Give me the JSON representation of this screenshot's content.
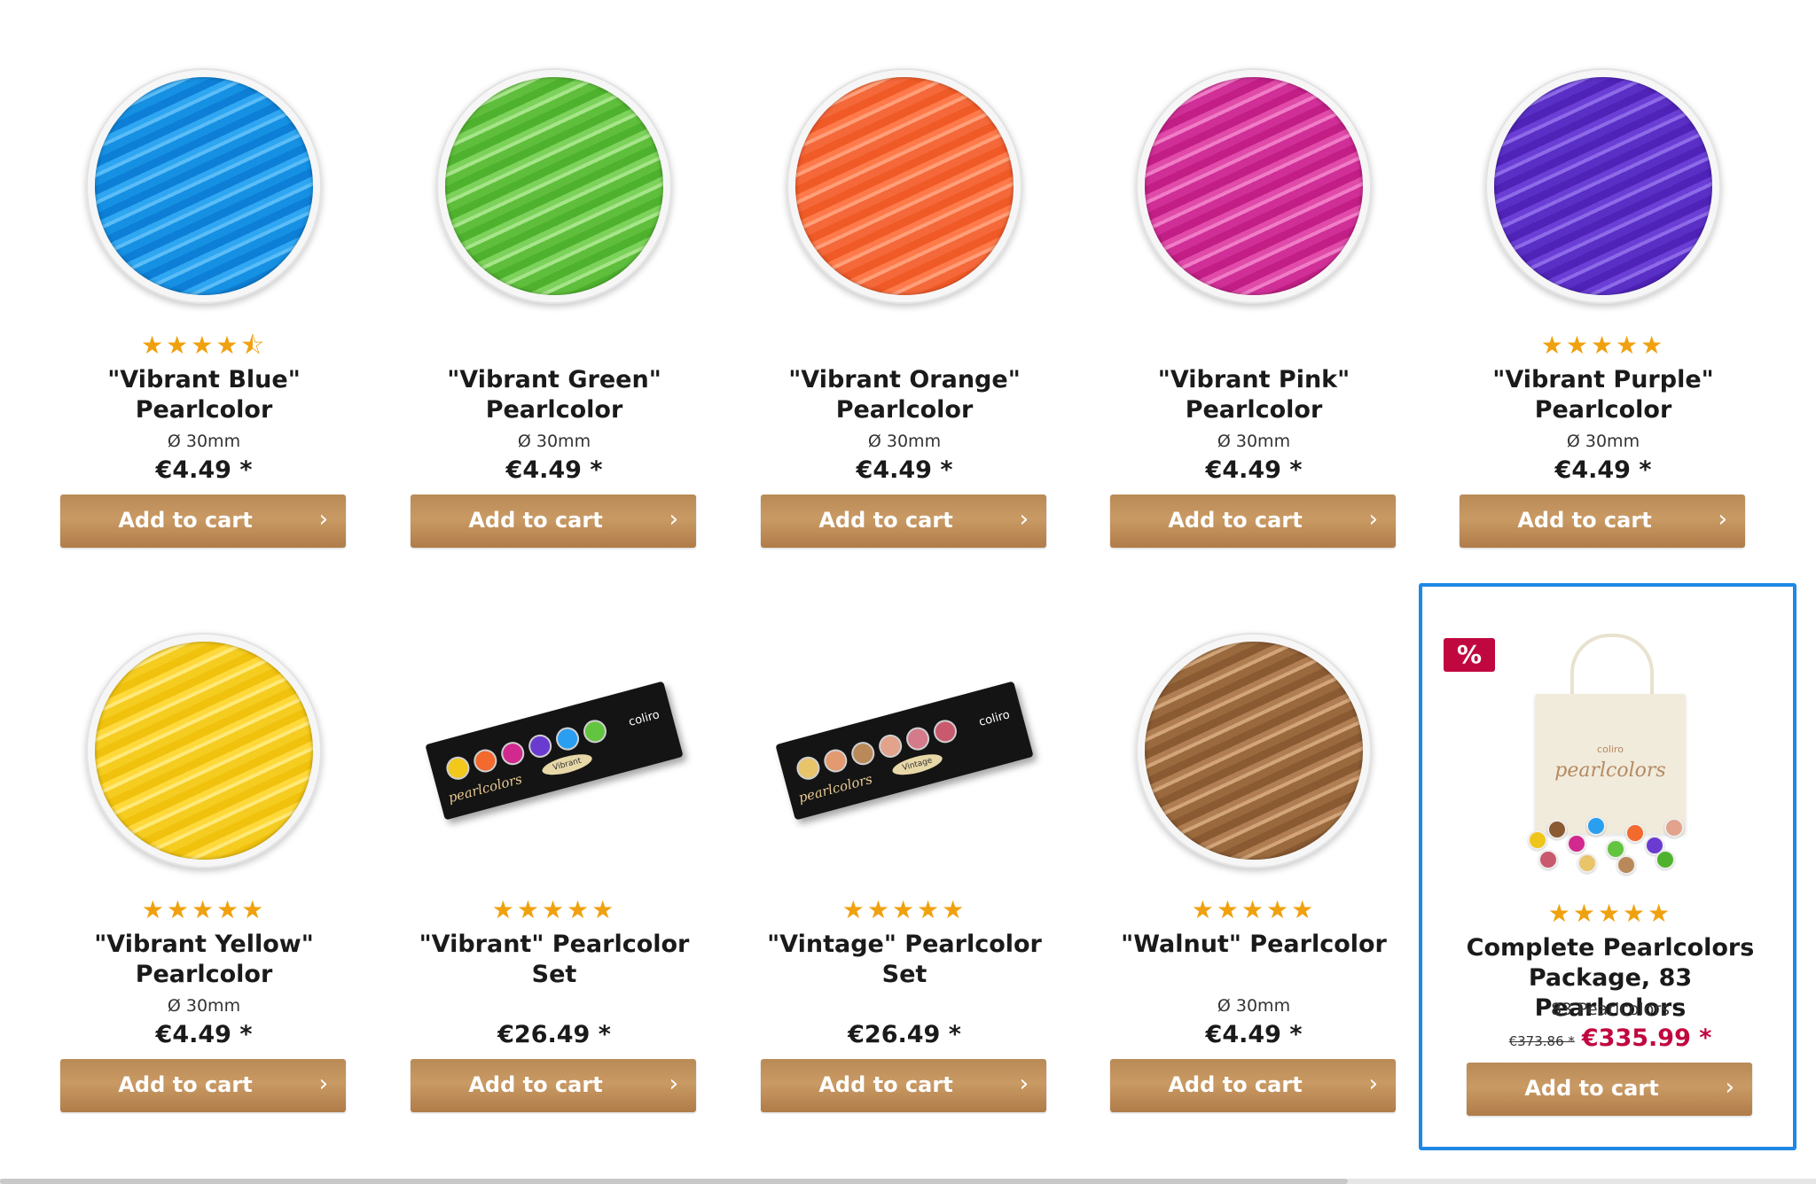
{
  "cart_button_label": "Add to cart",
  "arrow": "›",
  "sale_badge": "%",
  "row1": [
    {
      "title": "\"Vibrant Blue\" Pearlcolor",
      "rating": 4.5,
      "stars": "★★★★",
      "half_star": "⯪",
      "desc": "Ø 30mm",
      "price": "€4.49 *"
    },
    {
      "title": "\"Vibrant Green\" Pearlcolor",
      "rating": 0,
      "stars": "",
      "desc": "Ø 30mm",
      "price": "€4.49 *"
    },
    {
      "title": "\"Vibrant Orange\" Pearlcolor",
      "rating": 0,
      "stars": "",
      "desc": "Ø 30mm",
      "price": "€4.49 *"
    },
    {
      "title": "\"Vibrant Pink\" Pearlcolor",
      "rating": 0,
      "stars": "",
      "desc": "Ø 30mm",
      "price": "€4.49 *"
    },
    {
      "title": "\"Vibrant Purple\" Pearlcolor",
      "rating": 5,
      "stars": "★★★★★",
      "desc": "Ø 30mm",
      "price": "€4.49 *"
    }
  ],
  "row2": [
    {
      "title": "\"Vibrant Yellow\" Pearlcolor",
      "rating": 5,
      "stars": "★★★★★",
      "desc": "Ø 30mm",
      "price": "€4.49 *"
    },
    {
      "title": "\"Vibrant\" Pearlcolor Set",
      "rating": 5,
      "stars": "★★★★★",
      "desc": "",
      "price": "€26.49 *",
      "set_brand": "coliro",
      "set_script": "pearlcolors",
      "set_oval": "Vibrant"
    },
    {
      "title": "\"Vintage\" Pearlcolor Set",
      "rating": 5,
      "stars": "★★★★★",
      "desc": "",
      "price": "€26.49 *",
      "set_brand": "coliro",
      "set_script": "pearlcolors",
      "set_oval": "Vintage"
    },
    {
      "title": "\"Walnut\" Pearlcolor",
      "rating": 5,
      "stars": "★★★★★",
      "desc": "Ø 30mm",
      "price": "€4.49 *"
    },
    {
      "title": "Complete Pearlcolors Package, 83 Pearlcolors",
      "rating": 5,
      "stars": "★★★★★",
      "desc": "83 Pearlcolors",
      "old_price": "€373.86 *",
      "price": "€335.99 *",
      "bag_brand": "coliro",
      "bag_script": "pearlcolors"
    }
  ],
  "colors": {
    "accent_gold": "#c29360",
    "star": "#f0a10f",
    "sale": "#c1073f",
    "highlight_border": "#1e88e5"
  },
  "icons": {
    "product_arrow": "chevron-right-icon",
    "rating": "star-icon",
    "sale": "percent-icon"
  }
}
